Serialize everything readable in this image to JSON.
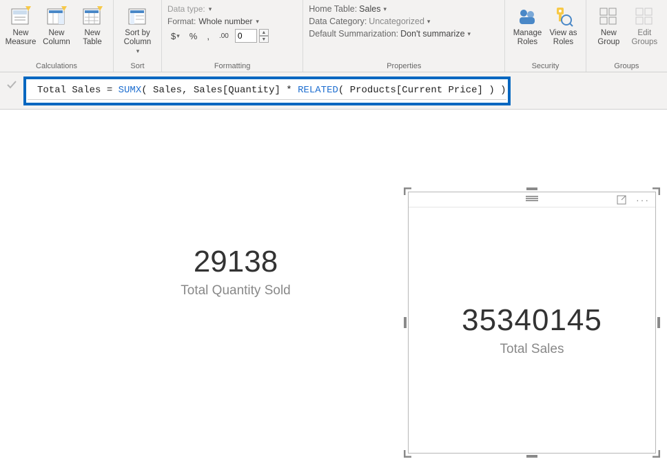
{
  "ribbon": {
    "calculations": {
      "label": "Calculations",
      "new_measure": "New Measure",
      "new_column": "New Column",
      "new_table": "New Table"
    },
    "sort": {
      "label": "Sort",
      "sort_by_column": "Sort by Column"
    },
    "formatting": {
      "label": "Formatting",
      "data_type_label": "Data type:",
      "format_label": "Format:",
      "format_value": "Whole number",
      "currency": "$",
      "percent": "%",
      "thousands": ",",
      "decimal_icon": ".00",
      "decimal_value": "0"
    },
    "properties": {
      "label": "Properties",
      "home_table_label": "Home Table:",
      "home_table_value": "Sales",
      "data_category_label": "Data Category:",
      "data_category_value": "Uncategorized",
      "summarization_label": "Default Summarization:",
      "summarization_value": "Don't summarize"
    },
    "security": {
      "label": "Security",
      "manage_roles": "Manage Roles",
      "view_as_roles": "View as Roles"
    },
    "groups": {
      "label": "Groups",
      "new_group": "New Group",
      "edit_groups": "Edit Groups"
    }
  },
  "formula": {
    "prefix": "Total Sales = ",
    "fn1": "SUMX",
    "mid1": "( Sales, Sales[Quantity] * ",
    "fn2": "RELATED",
    "mid2": "( Products[Current Price] ) )"
  },
  "card1": {
    "value": "29138",
    "label": "Total Quantity Sold"
  },
  "card2": {
    "value": "35340145",
    "label": "Total Sales"
  }
}
